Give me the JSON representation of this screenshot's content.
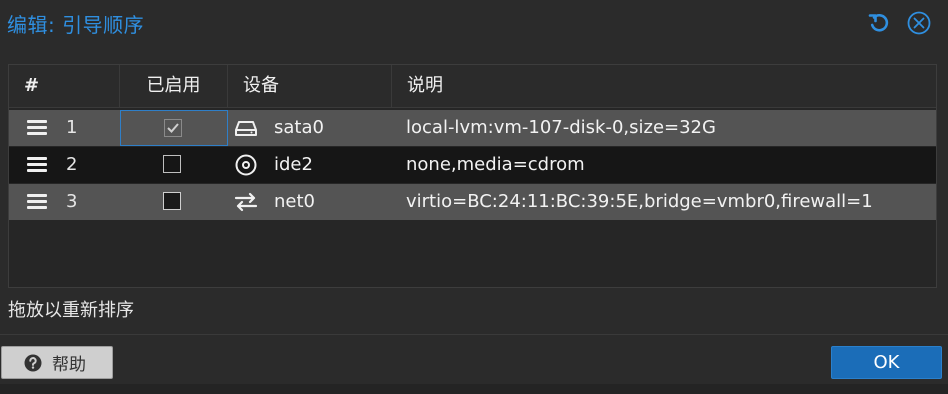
{
  "dialog": {
    "title": "编辑: 引导顺序",
    "tools": [
      {
        "icon": "refresh-icon"
      },
      {
        "icon": "close-icon"
      }
    ]
  },
  "grid": {
    "columns": [
      "#",
      "已启用",
      "设备",
      "说明"
    ],
    "rows": [
      {
        "num": "1",
        "enabled": true,
        "disabled_style": true,
        "device_icon": "hard-disk-icon",
        "device": "sata0",
        "description": "local-lvm:vm-107-disk-0,size=32G"
      },
      {
        "num": "2",
        "enabled": false,
        "disabled_style": false,
        "device_icon": "cdrom-icon",
        "device": "ide2",
        "description": "none,media=cdrom"
      },
      {
        "num": "3",
        "enabled": false,
        "disabled_style": false,
        "device_icon": "network-icon",
        "device": "net0",
        "description": "virtio=BC:24:11:BC:39:5E,bridge=vmbr0,firewall=1"
      }
    ]
  },
  "hint": "拖放以重新排序",
  "footer": {
    "help_label": "帮助",
    "ok_label": "OK"
  },
  "colors": {
    "accent": "#2f8fe0",
    "ok_button": "#1b6db8",
    "row_highlight": "#545454"
  }
}
